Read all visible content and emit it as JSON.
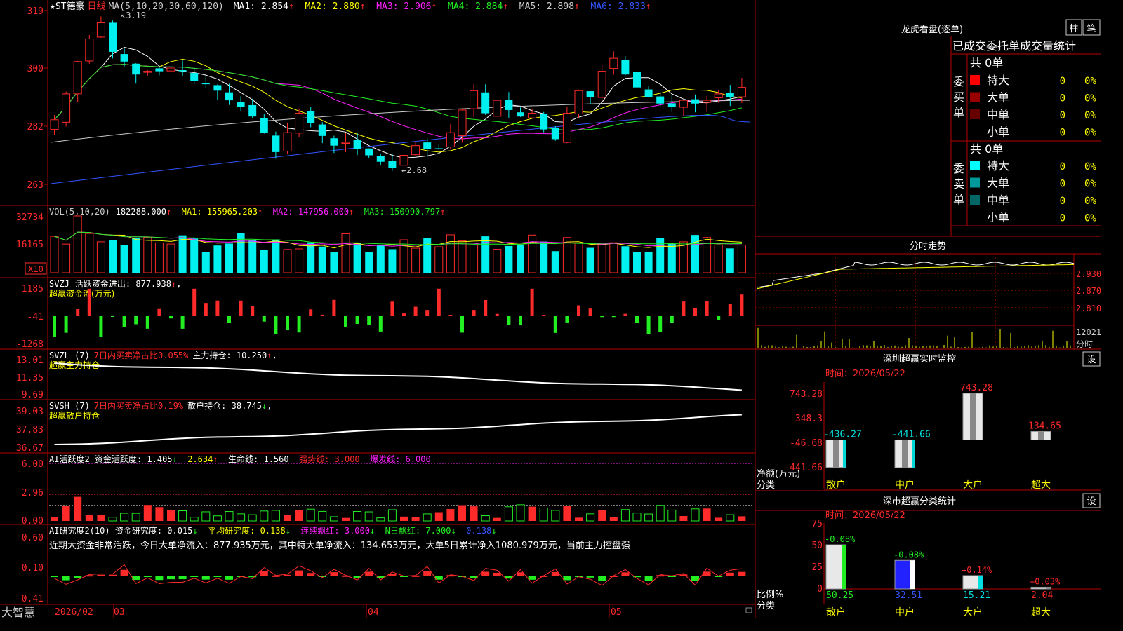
{
  "stock": {
    "name": "★ST德豪",
    "period": "日线"
  },
  "colors": {
    "up": "#ff2a2a",
    "down": "#00f0f0",
    "border": "#b40000",
    "green": "#22ee22",
    "yellow": "#ffff00",
    "magenta": "#ff22ff",
    "white": "#ffffff"
  },
  "price_panel": {
    "ma_label": "MA(5,10,20,30,60,120)",
    "ma": [
      {
        "name": "MA1",
        "value": "2.854",
        "color": "#ffffff"
      },
      {
        "name": "MA2",
        "value": "2.880",
        "color": "#ffff00"
      },
      {
        "name": "MA3",
        "value": "2.906",
        "color": "#ff22ff"
      },
      {
        "name": "MA4",
        "value": "2.884",
        "color": "#22ee22"
      },
      {
        "name": "MA5",
        "value": "2.898",
        "color": "#cccccc"
      },
      {
        "name": "MA6",
        "value": "2.833",
        "color": "#3355ff"
      }
    ],
    "y_ticks": [
      "319",
      "300",
      "282",
      "263"
    ],
    "high_label": "3.19",
    "low_label": "2.68"
  },
  "vol_panel": {
    "title": "VOL(5,10,20)",
    "value": "182288.000",
    "ma": [
      {
        "name": "MA1",
        "value": "155965.203",
        "color": "#ffff00"
      },
      {
        "name": "MA2",
        "value": "147956.000",
        "color": "#ff22ff"
      },
      {
        "name": "MA3",
        "value": "150990.797",
        "color": "#22ee22"
      }
    ],
    "y_ticks": [
      "32734",
      "16165"
    ],
    "unit": "X10"
  },
  "svzj_panel": {
    "title": "SVZJ",
    "label": "活跃资金进出",
    "value": "877.938",
    "subtitle": "超赢资金流(万元)",
    "y_ticks": [
      "1185",
      "-41",
      "-1268"
    ]
  },
  "svzl_panel": {
    "title": "SVZL (7)",
    "label1": "7日内买卖净占比0.055%",
    "label2": "主力持仓",
    "value": "10.250",
    "subtitle": "超赢主力持仓",
    "y_ticks": [
      "13.01",
      "11.35",
      "9.69"
    ]
  },
  "svsh_panel": {
    "title": "SVSH (7)",
    "label1": "7日内买卖净占比0.19%",
    "label2": "散户持仓",
    "value": "38.745",
    "subtitle": "超赢散户持仓",
    "y_ticks": [
      "39.03",
      "37.83",
      "36.67"
    ]
  },
  "ai_active_panel": {
    "title": "AI活跃度2",
    "items": [
      {
        "label": "资金活跃度",
        "value": "1.405",
        "color": "#ffffff"
      },
      {
        "label": "",
        "value": "2.634",
        "color": "#ffff00"
      },
      {
        "label": "生命线",
        "value": "1.560",
        "color": "#ffffff"
      },
      {
        "label": "强势线",
        "value": "3.000",
        "color": "#ff2a2a"
      },
      {
        "label": "爆发线",
        "value": "6.000",
        "color": "#ff22ff"
      }
    ],
    "y_ticks": [
      "6.00",
      "2.96",
      "0.00"
    ]
  },
  "ai_research_panel": {
    "title": "AI研究度2(10)",
    "items": [
      {
        "label": "资金研究度",
        "value": "0.015",
        "color": "#ffffff"
      },
      {
        "label": "平均研究度",
        "value": "0.138",
        "color": "#ffff00"
      },
      {
        "label": "连续飘红",
        "value": "3.000",
        "color": "#ff22ff"
      },
      {
        "label": "N日飘红",
        "value": "7.000",
        "color": "#22ee22"
      },
      {
        "label": "",
        "value": "0.138",
        "color": "#3355ff"
      }
    ],
    "comment": "近期大资金非常活跃，今日大单净流入：877.935万元，其中特大单净流入：134.653万元，大单5日累计净入1080.979万元，当前主力控盘强",
    "y_ticks": [
      "0.60",
      "0.10",
      "-0.41"
    ]
  },
  "x_axis": {
    "brand": "大智慧",
    "labels": [
      "2026/02",
      "03",
      "04",
      "05"
    ]
  },
  "dragon": {
    "title": "龙虎看盘(逐单)",
    "btn_bar": "柱",
    "btn_pen": "笔",
    "header": "已成交委托单成交量统计",
    "buy": {
      "side_label": "委买单",
      "total": "共 0单",
      "rows": [
        {
          "name": "特大",
          "count": "0",
          "pct": "0%",
          "color": "#ff0000"
        },
        {
          "name": "大单",
          "count": "0",
          "pct": "0%",
          "color": "#990000"
        },
        {
          "name": "中单",
          "count": "0",
          "pct": "0%",
          "color": "#660000"
        },
        {
          "name": "小单",
          "count": "0",
          "pct": "0%",
          "color": ""
        }
      ]
    },
    "sell": {
      "side_label": "委卖单",
      "total": "共 0单",
      "rows": [
        {
          "name": "特大",
          "count": "0",
          "pct": "0%",
          "color": "#00ffff"
        },
        {
          "name": "大单",
          "count": "0",
          "pct": "0%",
          "color": "#009999"
        },
        {
          "name": "中单",
          "count": "0",
          "pct": "0%",
          "color": "#006666"
        },
        {
          "name": "小单",
          "count": "0",
          "pct": "0%",
          "color": ""
        }
      ]
    }
  },
  "intraday": {
    "title": "分时走势",
    "y_ticks": [
      "2.930",
      "2.870",
      "2.810"
    ],
    "vol_label": "12021",
    "time_label": "分时"
  },
  "sz_monitor": {
    "title": "深圳超赢实时监控",
    "settings": "设",
    "time": "时间：2026/05/22",
    "y_ticks": [
      "743.28",
      "348.3",
      "-46.68",
      "-441.66"
    ],
    "axis_caption1": "净额(万元)",
    "axis_caption2": "分类",
    "bars": [
      {
        "name": "散户",
        "value": "-436.27",
        "num": -436.27
      },
      {
        "name": "中户",
        "value": "-441.66",
        "num": -441.66
      },
      {
        "name": "大户",
        "value": "743.28",
        "num": 743.28
      },
      {
        "name": "超大",
        "value": "134.65",
        "num": 134.65
      }
    ]
  },
  "sz_class": {
    "title": "深市超赢分类统计",
    "settings": "设",
    "time": "时间：2026/05/22",
    "y_ticks": [
      "75",
      "50",
      "25",
      "0"
    ],
    "axis_caption1": "比例%",
    "axis_caption2": "分类",
    "bars": [
      {
        "name": "散户",
        "value": "50.25",
        "change": "-0.08%",
        "num": 50.25
      },
      {
        "name": "中户",
        "value": "32.51",
        "change": "-0.08%",
        "num": 32.51
      },
      {
        "name": "大户",
        "value": "15.21",
        "change": "+0.14%",
        "num": 15.21
      },
      {
        "name": "超大",
        "value": "2.04",
        "change": "+0.03%",
        "num": 2.04
      }
    ]
  }
}
